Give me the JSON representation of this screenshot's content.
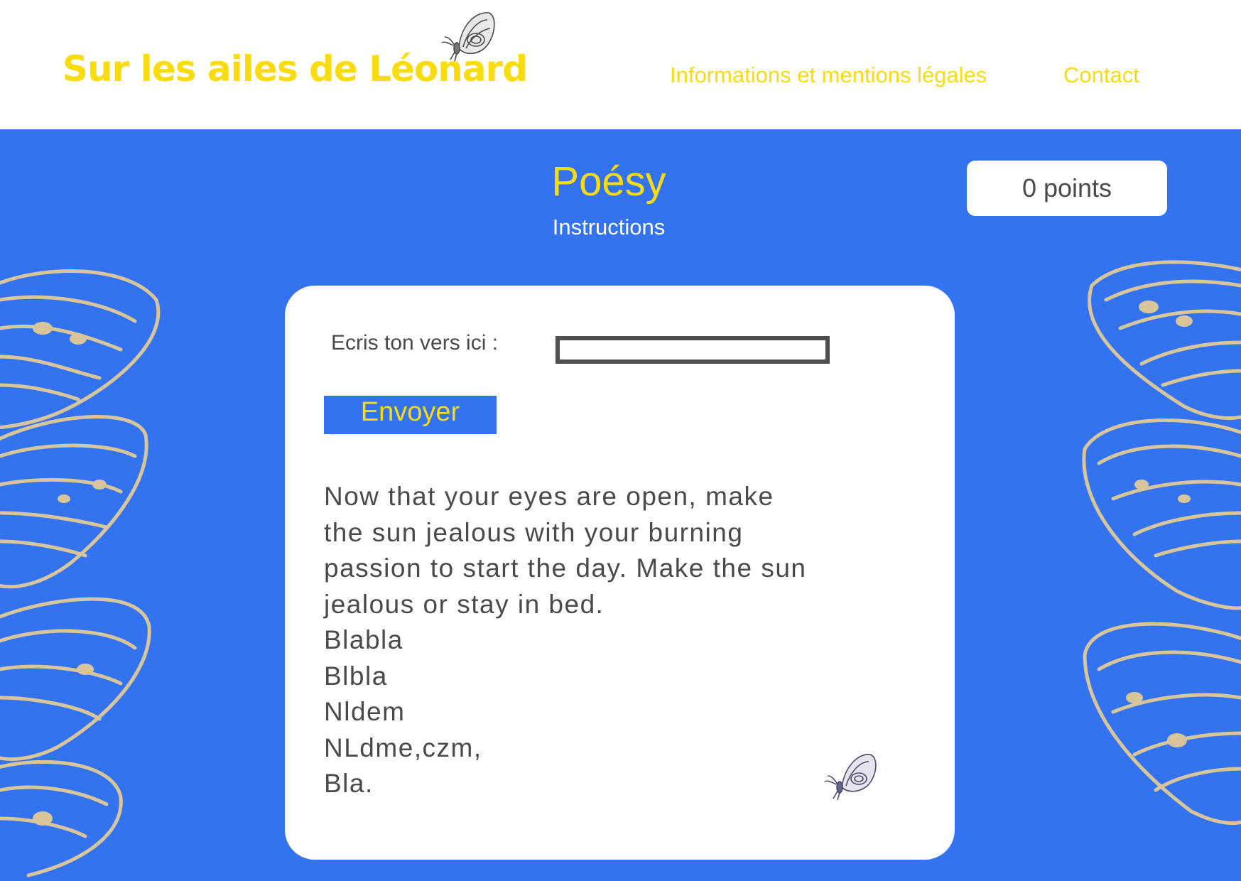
{
  "header": {
    "site_title": "Sur les ailes de Léonard",
    "nav": [
      {
        "label": "Informations et mentions légales"
      },
      {
        "label": "Contact"
      }
    ]
  },
  "game": {
    "title": "Poésy",
    "instructions_link": "Instructions",
    "score": "0 points"
  },
  "form": {
    "verse_label": "Ecris ton vers ici :",
    "verse_value": "",
    "send_label": "Envoyer"
  },
  "poem": {
    "intro": "Now that your eyes are open, make the sun jealous with your burning passion to start the day. Make the sun jealous or stay in bed.",
    "lines": [
      "Blabla",
      "Blbla",
      "Nldem",
      "NLdme,czm,",
      "Bla."
    ]
  },
  "colors": {
    "accent_yellow": "#f9dc10",
    "background_blue": "#3373f0",
    "text_gray": "#4a4a4a",
    "wing_beige": "#d9c59a"
  },
  "icons": {
    "header_decoration": "butterfly-icon",
    "card_decoration": "butterfly-icon"
  }
}
